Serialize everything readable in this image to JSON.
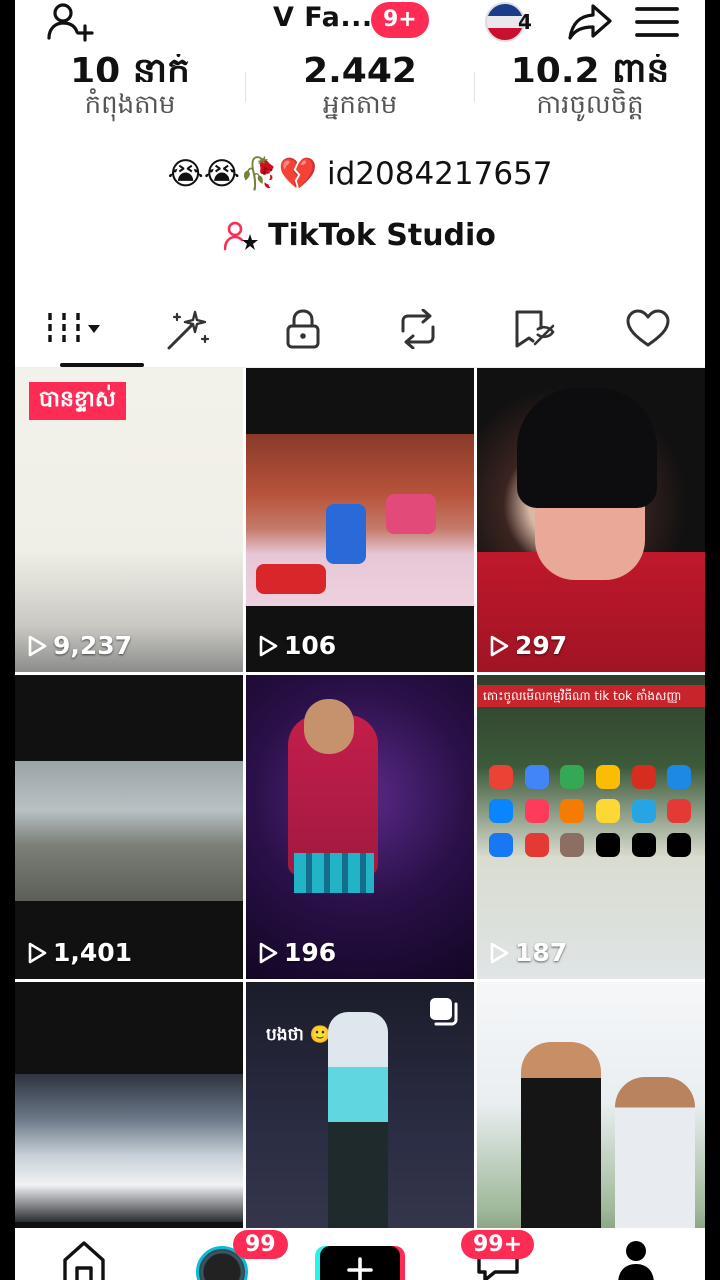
{
  "header": {
    "title": "V Fa...",
    "notification_badge": "9+",
    "profile_switch_count": "4"
  },
  "stats": [
    {
      "value": "10 នាក់",
      "label": "កំពុងតាម"
    },
    {
      "value": "2,442",
      "label": "អ្នកតាម"
    },
    {
      "value": "10.2 ពាន់",
      "label": "ការចូលចិត្ត"
    }
  ],
  "bio": {
    "emojis": "😭😭🥀💔",
    "id_text": "id2084217657"
  },
  "studio_label": "TikTok Studio",
  "tabs": [
    {
      "name": "videos",
      "icon": "grid-icon"
    },
    {
      "name": "favorites-effects",
      "icon": "sparkle-wand-icon"
    },
    {
      "name": "private",
      "icon": "lock-icon"
    },
    {
      "name": "reposts",
      "icon": "repost-icon"
    },
    {
      "name": "saved",
      "icon": "bookmark-off-icon"
    },
    {
      "name": "liked",
      "icon": "heart-icon"
    }
  ],
  "videos": [
    {
      "views": "9,237",
      "pinned_label": "បានខ្ទាស់"
    },
    {
      "views": "106"
    },
    {
      "views": "297"
    },
    {
      "views": "1,401"
    },
    {
      "views": "196"
    },
    {
      "views": "187",
      "banner_text": "តោះចូលមើលកម្មវិធីណា tik tok តាំងសញ្ញា"
    },
    {
      "views": ""
    },
    {
      "views": "",
      "caption": "បងថា 🙂"
    },
    {
      "views": ""
    }
  ],
  "bottom_nav": {
    "friends_badge": "99",
    "inbox_badge": "99+"
  },
  "colors": {
    "accent": "#fe2c55",
    "cyan": "#25f4ee",
    "text": "#111111"
  }
}
